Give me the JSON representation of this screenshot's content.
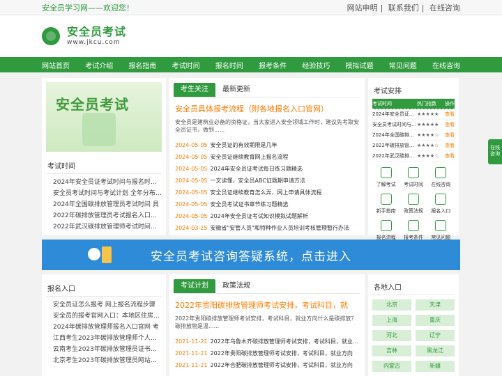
{
  "topbar": {
    "welcome": "安全员学习网——欢迎您！",
    "links": [
      "网站申明",
      "联系我们",
      "在线咨询"
    ]
  },
  "logo": {
    "title": "安全员考试",
    "domain": "www.jkcu.com"
  },
  "nav": [
    "网站首页",
    "考试介绍",
    "报名指南",
    "考试时间",
    "报名时间",
    "报考条件",
    "经验技巧",
    "模拟试题",
    "常见问题",
    "在线咨询"
  ],
  "left": {
    "banner_title": "安全员考试",
    "section_title": "考试时间",
    "items": [
      "2024年安全员证考试时间与报名时间新",
      "安全员考试时间与考试计划 全年分布情况",
      "2024年全国碳排放管理员考试时间 具",
      "2022年碳排放管理员考试报名入口已更",
      "2022年武汉碳排放管理师考试时间目前"
    ]
  },
  "mid": {
    "tabs": [
      "考生关注",
      "最新更新"
    ],
    "headline": "安全员具体报考流程（附各地报名入口官网）",
    "desc": "安全员是建筑业必备的资格证，当大家进入安全领域工作时，建议先考取安全员证书，做到......",
    "news": [
      {
        "date": "2024-05-05",
        "title": "安全员证的有效期限是几年"
      },
      {
        "date": "2024-05-05",
        "title": "安全员证继续教育网上报名流程"
      },
      {
        "date": "2024-05-05",
        "title": "2024年安全员证考试每日练习题精选"
      },
      {
        "date": "2024-05-05",
        "title": "一文读懂，安全员ABC证题期申请方法"
      },
      {
        "date": "2024-05-05",
        "title": "安全员证继续教育怎么弄，网上申请具体流程"
      },
      {
        "date": "2024-05-05",
        "title": "安全员考试证书章节练习题精选"
      },
      {
        "date": "2024-05-05",
        "title": "2024年安全员证考试知识模拟试题解析"
      },
      {
        "date": "2024-03-25",
        "title": "安徽省\"安管人员\"和特种作业人员培训考核管理暂行办法"
      }
    ]
  },
  "right": {
    "title": "考试安排",
    "header": {
      "c1": "考试时间",
      "c2": "热门指数",
      "c3": "操作"
    },
    "rows": [
      {
        "name": "2024年安全员证考试",
        "stars": "★★★★★",
        "op": "查看"
      },
      {
        "name": "安全员考试时间与考试",
        "stars": "★★★★★",
        "op": "查看"
      },
      {
        "name": "2024年全国碳排放管理",
        "stars": "★★★★☆",
        "op": "查看"
      },
      {
        "name": "2022年碳排放管理员",
        "stars": "★★★★☆",
        "op": "查看"
      },
      {
        "name": "2022年武汉碳排放管",
        "stars": "★★★★☆",
        "op": "查看"
      }
    ],
    "grid": [
      "了解考试",
      "考试时间",
      "在线咨询",
      "新手指南",
      "政策法规",
      "报名入口",
      "报名流程",
      "报考条件",
      "常见问题"
    ]
  },
  "bigbanner": {
    "text": "安全员考试咨询答疑系统，点击进入"
  },
  "bottom": {
    "left_title": "报名入口",
    "left_items": [
      "安全员证怎么报考 网上报名流程步骤",
      "安全员的报考官网入口：本地区住房和城乡",
      "2024年碳排放管理师报名入口官网 考",
      "江西考生2023年碳排放管理师个人报名",
      "云南考生2023年碳排放管理员证书个人",
      "北京考生2023年碳排放管理员网站报名"
    ],
    "mid_tabs": [
      "考试计划",
      "政策法规"
    ],
    "mid_headline": "2022年贵阳碳排放管理师考试安排，考试科目，就",
    "mid_desc": "2022年贵阳碳排放管理师考试安排，考试科目，就业方向什么是碳排放？碳排放物是温......",
    "mid_news": [
      {
        "date": "2021-11-21",
        "title": "2022年乌鲁木齐碳排放管理师考试安排，考试科目，就业方向"
      },
      {
        "date": "2021-11-21",
        "title": "2022年贵阳碳排放管理师考试安排，考试科目，就业方向"
      },
      {
        "date": "2021-11-21",
        "title": "2022年合肥碳排放管理师考试安排，考试科目，就业方向"
      }
    ],
    "right_title": "各地入口",
    "regions": [
      "北京",
      "天津",
      "上海",
      "重庆",
      "河北",
      "辽宁",
      "吉林",
      "黑龙江",
      "内蒙古",
      "新疆"
    ]
  },
  "float_consult": "在线咨询"
}
